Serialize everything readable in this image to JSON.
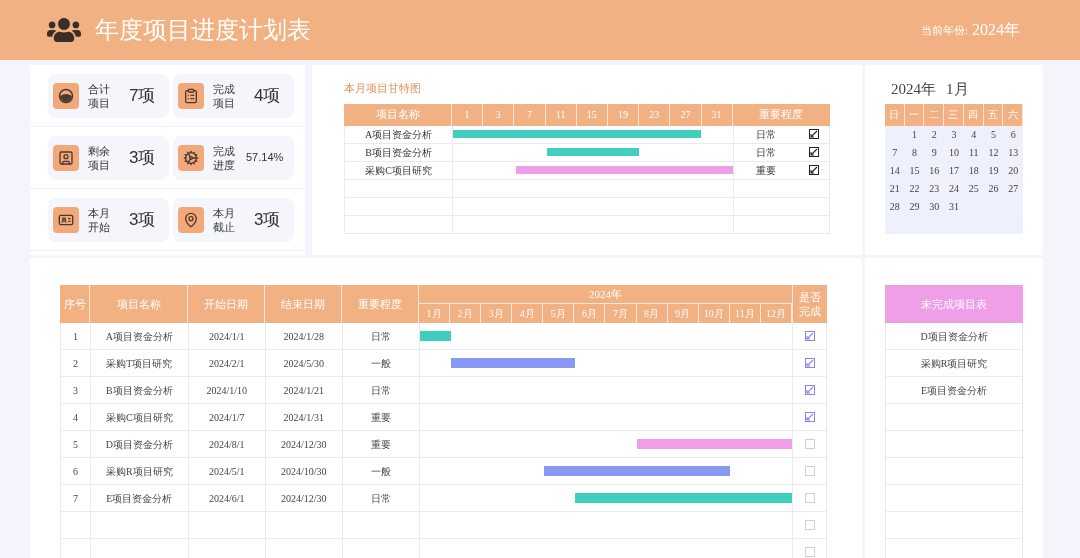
{
  "header": {
    "title": "年度项目进度计划表",
    "year_label": "当前年份:",
    "year": "2024年"
  },
  "stats": [
    {
      "kind": "total",
      "label": "合计项目",
      "value": "7项"
    },
    {
      "kind": "done",
      "label": "完成项目",
      "value": "4项"
    },
    {
      "kind": "remaining",
      "label": "剩余项目",
      "value": "3项"
    },
    {
      "kind": "progress",
      "label": "完成进度",
      "value": "57.14%"
    },
    {
      "kind": "start",
      "label": "本月开始",
      "value": "3项"
    },
    {
      "kind": "deadline",
      "label": "本月截止",
      "value": "3项"
    }
  ],
  "monthly_gantt": {
    "title": "本月项目甘特图",
    "name_header": "项目名称",
    "days": [
      "1",
      "3",
      "7",
      "11",
      "15",
      "19",
      "23",
      "27",
      "31"
    ],
    "importance_header": "重要程度",
    "rows": [
      {
        "name": "A项目资金分析",
        "importance": "日常",
        "color": "#3ecfbe",
        "bar_start": {
          "level": 0
        },
        "bar_end": {
          "level": 0.886
        },
        "checked": true
      },
      {
        "name": "B项目资金分析",
        "importance": "日常",
        "color": "#3ecfbe",
        "bar_start": {
          "level": 0.334
        },
        "bar_end": {
          "level": 0.665
        },
        "checked": true
      },
      {
        "name": "采购C项目研究",
        "importance": "重要",
        "color": "#ee9fe8",
        "bar_start": {
          "level": 0.224
        },
        "bar_end": {
          "level": 1
        },
        "checked": true
      }
    ]
  },
  "calendar": {
    "year": "2024年",
    "month": "1月",
    "weekdays": [
      "日",
      "一",
      "二",
      "三",
      "四",
      "五",
      "六"
    ],
    "weeks": [
      {
        "kind": "first",
        "days": [
          "1",
          "2",
          "3",
          "4",
          "5",
          "6"
        ]
      },
      {
        "kind": "full",
        "days": [
          "7",
          "8",
          "9",
          "10",
          "11",
          "12",
          "13"
        ]
      },
      {
        "kind": "full",
        "days": [
          "14",
          "15",
          "16",
          "17",
          "18",
          "19",
          "20"
        ]
      },
      {
        "kind": "full",
        "days": [
          "21",
          "22",
          "23",
          "24",
          "25",
          "26",
          "27"
        ]
      },
      {
        "kind": "last",
        "days": [
          "28",
          "29",
          "30",
          "31"
        ]
      }
    ]
  },
  "project_table": {
    "columns": [
      "序号",
      "项目名称",
      "开始日期",
      "结束日期",
      "重要程度"
    ],
    "year": "2024年",
    "months": [
      "1月",
      "2月",
      "3月",
      "4月",
      "5月",
      "6月",
      "7月",
      "8月",
      "9月",
      "10月",
      "11月",
      "12月"
    ],
    "done_header": "是否完成",
    "rows": [
      {
        "no": "1",
        "name": "A项目资金分析",
        "start": "2024/1/1",
        "end": "2024/1/28",
        "importance": "日常",
        "color": "#3ecfbe",
        "bar_start": {
          "level": 0
        },
        "bar_end": {
          "level": 0.0833
        },
        "checked": true
      },
      {
        "no": "2",
        "name": "采购T项目研究",
        "start": "2024/2/1",
        "end": "2024/5/30",
        "importance": "一般",
        "color": "#8898f5",
        "bar_start": {
          "level": 0.0833
        },
        "bar_end": {
          "level": 0.4167
        },
        "checked": true
      },
      {
        "no": "3",
        "name": "B项目资金分析",
        "start": "2024/1/10",
        "end": "2024/1/21",
        "importance": "日常",
        "checked": true
      },
      {
        "no": "4",
        "name": "采购C项目研究",
        "start": "2024/1/7",
        "end": "2024/1/31",
        "importance": "重要",
        "checked": true
      },
      {
        "no": "5",
        "name": "D项目资金分析",
        "start": "2024/8/1",
        "end": "2024/12/30",
        "importance": "重要",
        "color": "#ee9fe8",
        "bar_start": {
          "level": 0.5833
        },
        "bar_end": {
          "level": 1
        },
        "checked": false
      },
      {
        "no": "6",
        "name": "采购R项目研究",
        "start": "2024/5/1",
        "end": "2024/10/30",
        "importance": "一般",
        "color": "#8898f5",
        "bar_start": {
          "level": 0.3333
        },
        "bar_end": {
          "level": 0.8333
        },
        "checked": false
      },
      {
        "no": "7",
        "name": "E项目资金分析",
        "start": "2024/6/1",
        "end": "2024/12/30",
        "importance": "日常",
        "color": "#3ecfbe",
        "bar_start": {
          "level": 0.4167
        },
        "bar_end": {
          "level": 1
        },
        "checked": false
      }
    ],
    "empty_rows": [
      {
        "checked": false
      },
      {
        "checked": false
      }
    ]
  },
  "unfinished": {
    "title": "未完成项目表",
    "items": [
      "D项目资金分析",
      "采购R项目研究",
      "E项目资金分析"
    ]
  }
}
